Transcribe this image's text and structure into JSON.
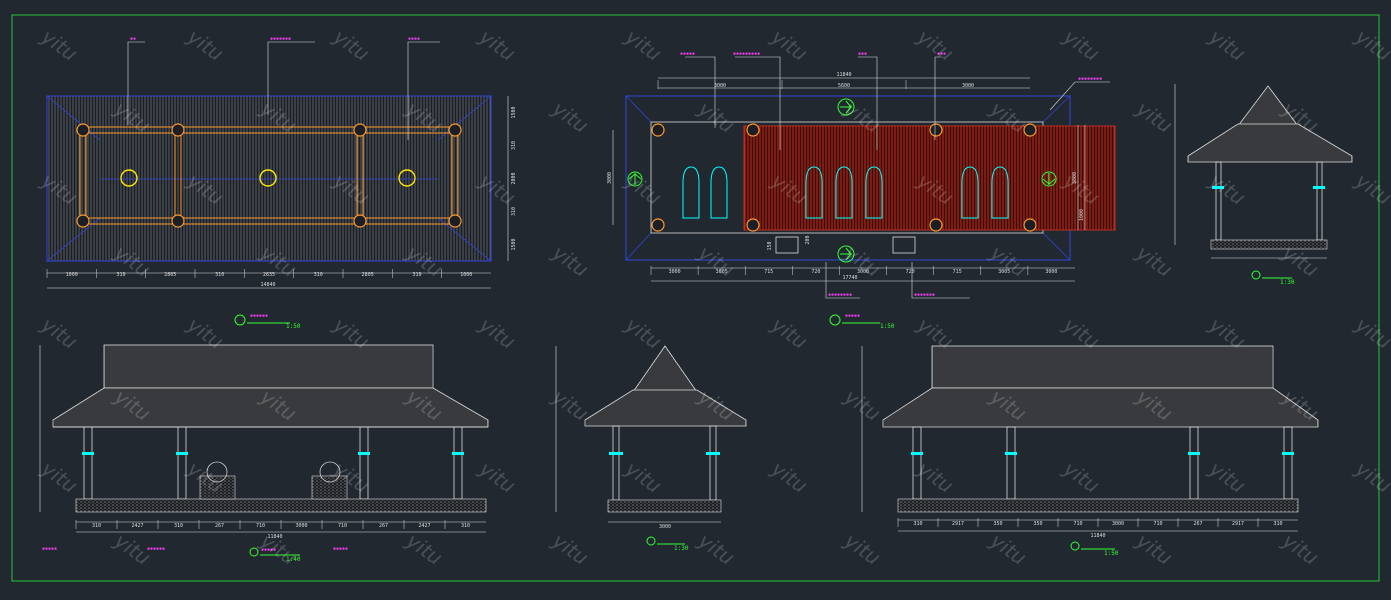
{
  "watermark": "yitu",
  "colors": {
    "background": "#212830",
    "frame": "#22c63a",
    "roof_edge": "#3344dd",
    "beam": "#ff9a2a",
    "column_ring": "#ffe600",
    "seat": "#00ffff",
    "deck": "#d12a1a",
    "annotation": "#ff40ff",
    "scale_label": "#33ff33",
    "line": "#dddddd"
  },
  "roof_plan": {
    "total_width": "14840",
    "dims_bottom": [
      "1000",
      "310",
      "2805",
      "310",
      "2635",
      "310",
      "2805",
      "310",
      "1000"
    ],
    "dims_right": [
      "1500",
      "310",
      "2000",
      "310",
      "1500"
    ],
    "scale": "1:50"
  },
  "floor_plan": {
    "top_total": "11840",
    "top_dims": [
      "3000",
      "5600",
      "3000"
    ],
    "left_dim": "3000",
    "right_dims": [
      "3000",
      "1000"
    ],
    "bottom_total": "17740",
    "bottom_dims": [
      "3000",
      "3005",
      "715",
      "720",
      "3000",
      "720",
      "715",
      "3005",
      "3000"
    ],
    "step_dims": [
      "150",
      "200"
    ],
    "scale": "1:50"
  },
  "side_section": {
    "scale": "1:30"
  },
  "front_elevation": {
    "total_width": "11840",
    "dims": [
      "310",
      "2427",
      "310",
      "267",
      "710",
      "3000",
      "710",
      "267",
      "2427",
      "310"
    ],
    "scale": "1:40"
  },
  "side_elevation": {
    "total_width": "3000",
    "scale": "1:30"
  },
  "rear_elevation": {
    "total_width": "11840",
    "dims": [
      "310",
      "2917",
      "350",
      "350",
      "710",
      "3000",
      "710",
      "267",
      "2917",
      "310"
    ],
    "scale": "1:50"
  }
}
